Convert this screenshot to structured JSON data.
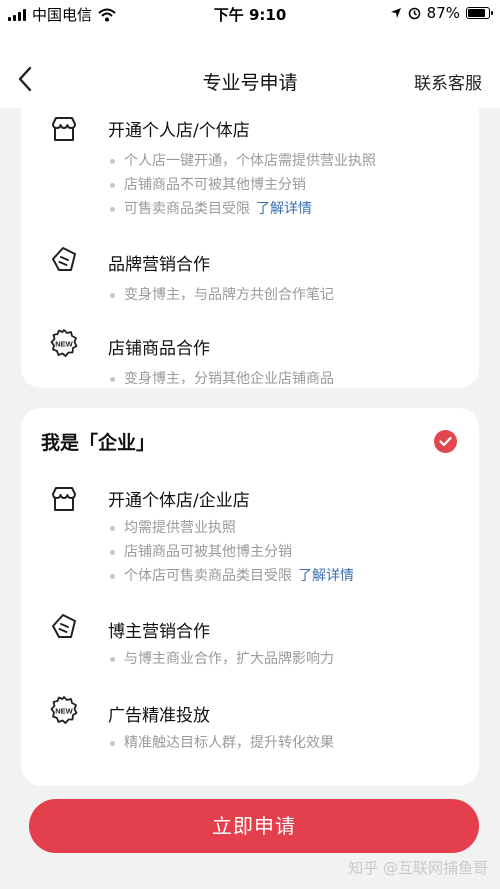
{
  "status_bar": {
    "carrier": "中国电信",
    "time": "下午 9:10",
    "battery_percent": "87%",
    "battery_level": 0.87
  },
  "nav": {
    "title": "专业号申请",
    "right_action": "联系客服"
  },
  "card_personal": {
    "features": [
      {
        "icon": "shop-icon",
        "title": "开通个人店/个体店",
        "bullets": [
          {
            "text": "个人店一键开通，个体店需提供营业执照"
          },
          {
            "text": "店铺商品不可被其他博主分销"
          },
          {
            "text": "可售卖商品类目受限",
            "link": "了解详情"
          }
        ]
      },
      {
        "icon": "note-tag-icon",
        "title": "品牌营销合作",
        "bullets": [
          {
            "text": "变身博主，与品牌方共创合作笔记"
          }
        ]
      },
      {
        "icon": "new-badge-icon",
        "title": "店铺商品合作",
        "bullets": [
          {
            "text": "变身博主，分销其他企业店铺商品"
          }
        ]
      }
    ]
  },
  "card_enterprise": {
    "title": "我是「企业」",
    "selected": true,
    "features": [
      {
        "icon": "shop-icon",
        "title": "开通个体店/企业店",
        "bullets": [
          {
            "text": "均需提供营业执照"
          },
          {
            "text": "店铺商品可被其他博主分销"
          },
          {
            "text": "个体店可售卖商品类目受限",
            "link": "了解详情"
          }
        ]
      },
      {
        "icon": "note-tag-icon",
        "title": "博主营销合作",
        "bullets": [
          {
            "text": "与博主商业合作，扩大品牌影响力"
          }
        ]
      },
      {
        "icon": "new-badge-icon",
        "title": "广告精准投放",
        "bullets": [
          {
            "text": "精准触达目标人群，提升转化效果"
          }
        ]
      }
    ]
  },
  "apply_button": "立即申请",
  "watermark": "知乎 @互联网捕鱼哥",
  "colors": {
    "accent": "#e43f4c",
    "link": "#3e6fb3",
    "background": "#f2f2f2"
  }
}
